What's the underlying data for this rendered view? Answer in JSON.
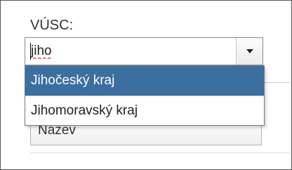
{
  "filter": {
    "label": "VÚSC:",
    "input_value": "jiho",
    "dropdown_icon": "triangle-down-icon",
    "options": [
      {
        "label": "Jihočeský kraj",
        "highlighted": true
      },
      {
        "label": "Jihomoravský kraj",
        "highlighted": false
      }
    ]
  },
  "table": {
    "column_header": "Název"
  },
  "colors": {
    "highlight": "#3a6fa0",
    "spellcheck_underline": "#d01c1c"
  }
}
